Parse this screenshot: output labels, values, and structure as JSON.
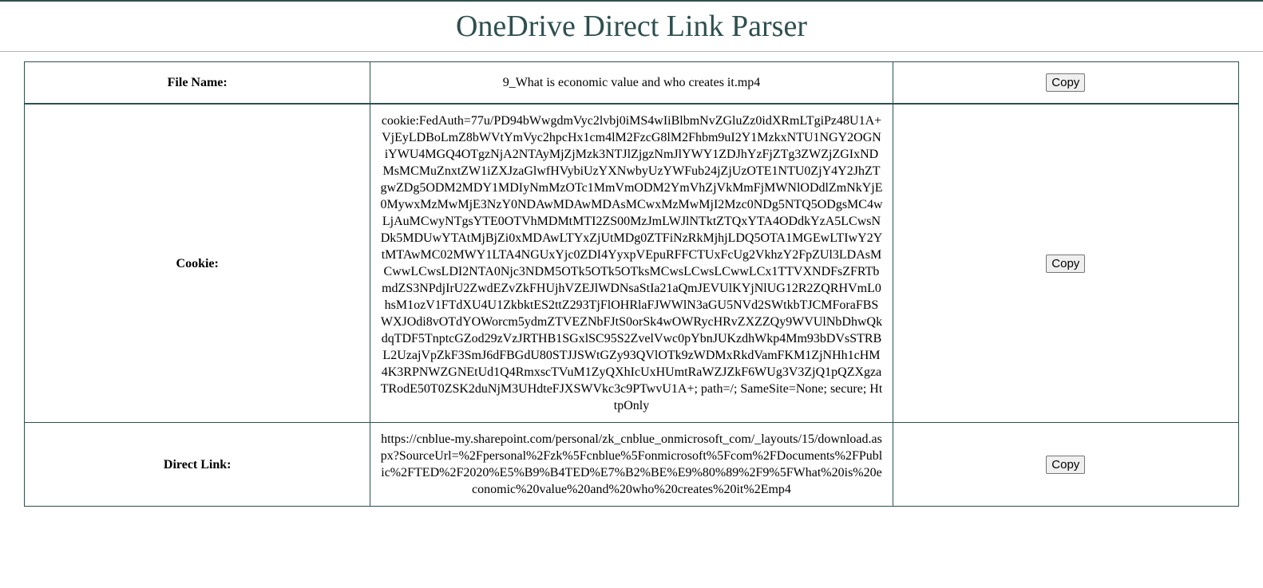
{
  "page": {
    "title": "OneDrive Direct Link Parser"
  },
  "rows": [
    {
      "label": "File Name:",
      "value": "9_What is economic value and who creates it.mp4",
      "button": "Copy"
    },
    {
      "label": "Cookie:",
      "value": "cookie:FedAuth=77u/PD94bWwgdmVyc2lvbj0iMS4wIiBlbmNvZGluZz0idXRmLTgiPz48U1A+VjEyLDBoLmZ8bWVtYmVyc2hpcHx1cm4lM2FzcG8lM2Fhbm9uI2Y1MzkxNTU1NGY2OGNiYWU4MGQ4OTgzNjA2NTAyMjZjMzk3NTJlZjgzNmJlYWY1ZDJhYzFjZTg3ZWZjZGIxNDMsMCMuZnxtZW1iZXJzaGlwfHVybiUzYXNwbyUzYWFub24jZjUzOTE1NTU0ZjY4Y2JhZTgwZDg5ODM2MDY1MDIyNmMzOTc1MmVmODM2YmVhZjVkMmFjMWNlODdlZmNkYjE0MywxMzMwMjE3NzY0NDAwMDAwMDAsMCwxMzMwMjI2Mzc0NDg5NTQ5ODgsMC4wLjAuMCwyNTgsYTE0OTVhMDMtMTI2ZS00MzJmLWJlNTktZTQxYTA4ODdkYzA5LCwsNDk5MDUwYTAtMjBjZi0xMDAwLTYxZjUtMDg0ZTFiNzRkMjhjLDQ5OTA1MGEwLTIwY2YtMTAwMC02MWY1LTA4NGUxYjc0ZDI4YyxpVEpuRFFCTUxFcUg2VkhzY2FpZUl3LDAsMCwwLCwsLDI2NTA0Njc3NDM5OTk5OTk5OTksMCwsLCwsLCwwLCx1TTVXNDFsZFRTbmdZS3NPdjIrU2ZwdEZvZkFHUjhVZEJlWDNsaStIa21aQmJEVUlKYjNlUG12R2ZQRHVmL0hsM1ozV1FTdXU4U1ZkbktES2ttZ293TjFlOHRlaFJWWlN3aGU5NVd2SWtkbTJCMForaFBSWXJOdi8vOTdYOWorcm5ydmZTVEZNbFJtS0orSk4wOWRycHRvZXZZQy9WVUlNbDhwQkdqTDF5TnptcGZod29zVzJRTHB1SGxlSC95S2ZvelVwc0pYbnJUKzdhWkp4Mm93bDVsSTRBL2UzajVpZkF3SmJ6dFBGdU80STJJSWtGZy93QVlOTk9zWDMxRkdVamFKM1ZjNHh1cHM4K3RPNWZGNEtUd1Q4RmxscTVuM1ZyQXhIcUxHUmtRaWZJZkF6WUg3V3ZjQ1pQZXgzaTRodE50T0ZSK2duNjM3UHdteFJXSWVkc3c9PTwvU1A+; path=/; SameSite=None; secure; HttpOnly",
      "button": "Copy"
    },
    {
      "label": "Direct Link:",
      "value": "https://cnblue-my.sharepoint.com/personal/zk_cnblue_onmicrosoft_com/_layouts/15/download.aspx?SourceUrl=%2Fpersonal%2Fzk%5Fcnblue%5Fonmicrosoft%5Fcom%2FDocuments%2FPublic%2FTED%2F2020%E5%B9%B4TED%E7%B2%BE%E9%80%89%2F9%5FWhat%20is%20economic%20value%20and%20who%20creates%20it%2Emp4",
      "button": "Copy"
    }
  ]
}
